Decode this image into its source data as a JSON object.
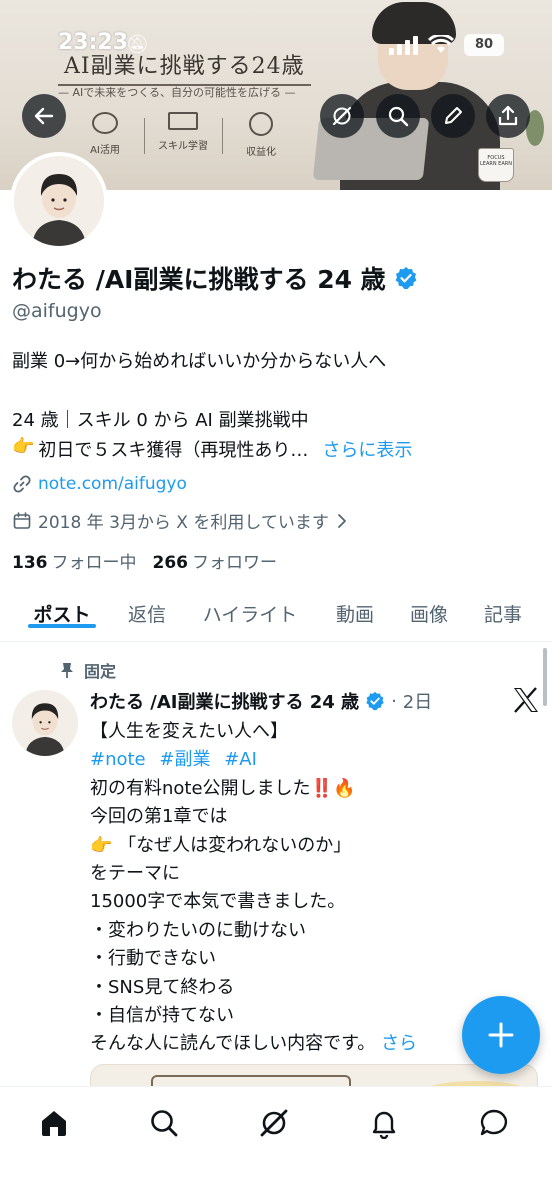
{
  "status_bar": {
    "time": "23:23",
    "battery": "80"
  },
  "banner": {
    "title": "AI副業に挑戦する24歳",
    "subtitle": "— AIで未来をつくる、自分の可能性を広げる —",
    "tiles": [
      "AI活用",
      "スキル学習",
      "収益化"
    ],
    "mug_text": "FOCUS LEARN EARN"
  },
  "profile": {
    "display_name": "わたる /AI副業に挑戦する 24 歳",
    "handle": "@aifugyo",
    "bio_line1": "副業 0→何から始めればいいか分からない人へ",
    "bio_line2": "24 歳｜スキル 0 から AI 副業挑戦中",
    "bio_line3_emoji": "👉",
    "bio_line3": "初日で５スキ獲得（再現性あり…",
    "bio_more": "さらに表示",
    "link": "note.com/aifugyo",
    "joined": "2018 年 3月から X を利用しています",
    "following_count": "136",
    "following_label": "フォロー中",
    "followers_count": "266",
    "followers_label": "フォロワー",
    "verified_color": "#1d9bf0"
  },
  "tabs": [
    "ポスト",
    "返信",
    "ハイライト",
    "動画",
    "画像",
    "記事"
  ],
  "pinned_post": {
    "pinned_label": "固定",
    "author": "わたる /AI副業に挑戦する 24 歳",
    "date": "2日",
    "lines": [
      "【人生を変えたい人へ】",
      "初の有料note公開しました‼️🔥",
      "今回の第1章では",
      "👉 「なぜ人は変われないのか」",
      "をテーマに",
      "15000字で本気で書きました。",
      "・変わりたいのに動けない",
      "・行動できない",
      "・SNS見て終わる",
      "・自信が持てない",
      "そんな人に読んでほしい内容です。"
    ],
    "hashtags": [
      "#note",
      "#副業",
      "#AI"
    ],
    "more": "さら"
  },
  "colors": {
    "accent": "#1d9bf0",
    "text": "#0f1419",
    "secondary": "#536471"
  },
  "icons": {
    "back": "arrow-left-icon",
    "grok": "grok-icon",
    "search": "search-icon",
    "edit": "pencil-icon",
    "share": "share-icon",
    "link": "link-icon",
    "calendar": "calendar-icon",
    "pin": "pin-icon",
    "compose": "plus-icon",
    "home": "home-icon",
    "notifications": "bell-icon",
    "messages": "message-icon"
  }
}
